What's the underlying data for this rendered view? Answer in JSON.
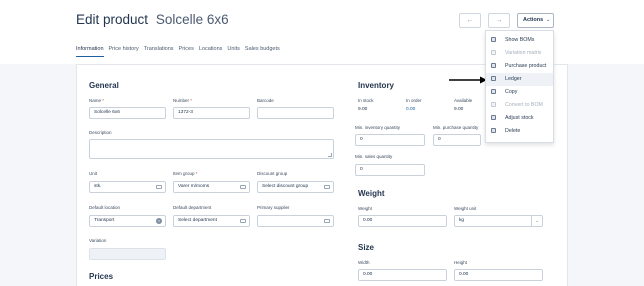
{
  "header": {
    "title": "Edit product",
    "product_name": "Solcelle 6x6",
    "prev_label": "←",
    "next_label": "→",
    "actions_label": "Actions",
    "actions_chevron": "⌄"
  },
  "tabs": [
    {
      "label": "Information"
    },
    {
      "label": "Price history"
    },
    {
      "label": "Translations"
    },
    {
      "label": "Prices"
    },
    {
      "label": "Locations"
    },
    {
      "label": "Units"
    },
    {
      "label": "Sales budgets"
    }
  ],
  "general": {
    "heading": "General",
    "name": {
      "label": "Name",
      "required": "*",
      "value": "Solcelle 6x6"
    },
    "number": {
      "label": "Number",
      "required": "*",
      "value": "1372-3"
    },
    "barcode": {
      "label": "Barcode",
      "value": ""
    },
    "description": {
      "label": "Description",
      "value": ""
    },
    "unit": {
      "label": "Unit",
      "value": "stk."
    },
    "item_group": {
      "label": "Item group",
      "required": "*",
      "value": "Varer m/moms"
    },
    "discount_group": {
      "label": "Discount group",
      "value": "Select discount group"
    },
    "default_location": {
      "label": "Default location",
      "value": "Transport",
      "clear": "×"
    },
    "default_department": {
      "label": "Default department",
      "value": "Select department"
    },
    "primary_supplier": {
      "label": "Primary supplier",
      "value": ""
    },
    "variation": {
      "label": "Variation",
      "value": ""
    }
  },
  "prices": {
    "heading": "Prices"
  },
  "inventory": {
    "heading": "Inventory",
    "in_stock": {
      "label": "In stock",
      "value": "9.00"
    },
    "in_order": {
      "label": "In order",
      "value": "0.00"
    },
    "available": {
      "label": "Available",
      "value": "9.00"
    },
    "min_inventory_quantity": {
      "label": "Min. inventory quantity",
      "value": "0"
    },
    "min_purchase_quantity": {
      "label": "Min. purchase quantity",
      "value": "0"
    },
    "min_sales_quantity": {
      "label": "Min. sales quantity",
      "value": "0"
    }
  },
  "weight": {
    "heading": "Weight",
    "weight": {
      "label": "Weight",
      "value": "0.00"
    },
    "weight_unit": {
      "label": "Weight unit",
      "value": "kg",
      "chevron": "⌄"
    }
  },
  "size": {
    "heading": "Size",
    "width": {
      "label": "Width",
      "value": "0.00"
    },
    "height": {
      "label": "Height",
      "value": "0.00"
    }
  },
  "actions_menu": {
    "items": [
      {
        "label": "Show BOMs",
        "enabled": true
      },
      {
        "label": "Variation matrix",
        "enabled": false
      },
      {
        "label": "Purchase product",
        "enabled": true
      },
      {
        "label": "Ledger",
        "enabled": true,
        "highlighted": true
      },
      {
        "label": "Copy",
        "enabled": true
      },
      {
        "label": "Convert to BOM",
        "enabled": false
      },
      {
        "label": "Adjust stock",
        "enabled": true
      },
      {
        "label": "Delete",
        "enabled": true
      }
    ]
  },
  "colors": {
    "accent": "#1d5fa0",
    "required": "#d24b4b",
    "disabled_text": "#a6b0bd"
  }
}
